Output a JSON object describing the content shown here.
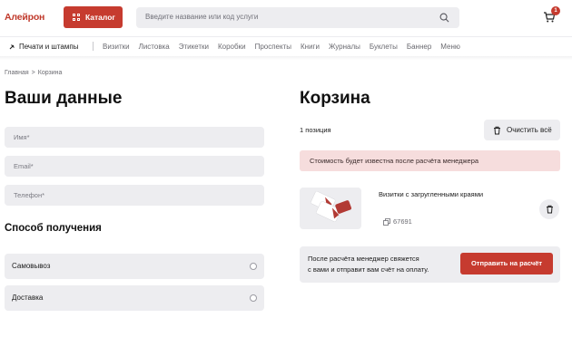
{
  "header": {
    "logo": "Алейрон",
    "catalog_label": "Каталог",
    "search_placeholder": "Введите название или код услуги",
    "cart_count": "1"
  },
  "nav": {
    "first": "Печати и штампы",
    "items": [
      "Визитки",
      "Листовка",
      "Этикетки",
      "Коробки",
      "Проспекты",
      "Книги",
      "Журналы",
      "Буклеты",
      "Баннер",
      "Меню"
    ]
  },
  "breadcrumb": {
    "home": "Главная",
    "separator": ">",
    "current": "Корзина"
  },
  "form": {
    "title": "Ваши данные",
    "name_placeholder": "Имя*",
    "email_placeholder": "Email*",
    "phone_placeholder": "Телефон*",
    "delivery_title": "Способ получения",
    "options": [
      "Самовывоз",
      "Доставка"
    ]
  },
  "cart": {
    "title": "Корзина",
    "positions": "1 позиция",
    "clear_label": "Очистить всё",
    "notice": "Стоимость будет известна после расчёта менеджера",
    "item": {
      "name": "Визитки с загругленными краями",
      "code": "67691"
    },
    "info_line1": "После расчёта менеджер свяжется",
    "info_line2": "с вами и отправит вам счёт на оплату.",
    "submit_label": "Отправить на расчёт"
  },
  "colors": {
    "accent": "#c63b2f",
    "field_bg": "#ededf0",
    "notice_bg": "#f6dddd"
  }
}
